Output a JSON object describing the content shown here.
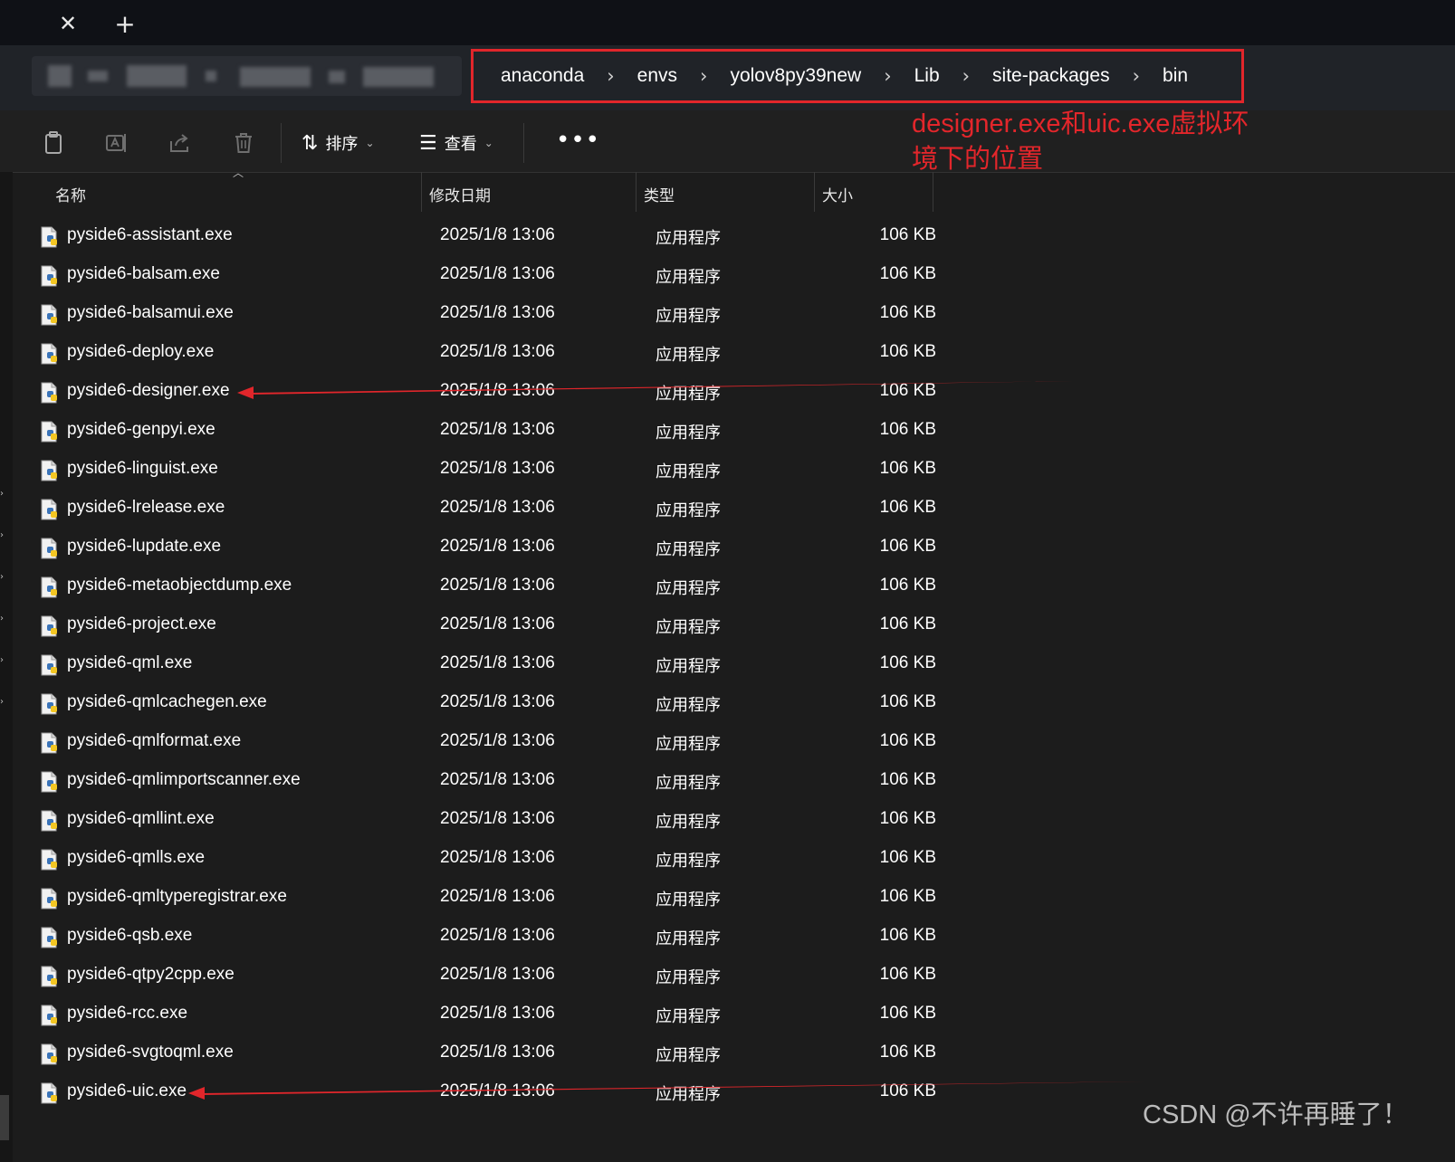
{
  "tabbar": {
    "close_glyph": "✕",
    "new_tab_glyph": "+"
  },
  "breadcrumbs": [
    "anaconda",
    "envs",
    "yolov8py39new",
    "Lib",
    "site-packages",
    "bin"
  ],
  "toolbar": {
    "icons": [
      "clipboard-icon",
      "rename-icon",
      "share-icon",
      "delete-icon"
    ],
    "sort_label": "排序",
    "view_label": "查看",
    "more_label": "•••"
  },
  "annotation": {
    "text_line1": "designer.exe和uic.exe虚拟环",
    "text_line2": "境下的位置",
    "color": "#e3262b"
  },
  "columns": {
    "name": "名称",
    "date": "修改日期",
    "type": "类型",
    "size": "大小"
  },
  "files": [
    {
      "name": "pyside6-assistant.exe",
      "date": "2025/1/8 13:06",
      "type": "应用程序",
      "size": "106 KB"
    },
    {
      "name": "pyside6-balsam.exe",
      "date": "2025/1/8 13:06",
      "type": "应用程序",
      "size": "106 KB"
    },
    {
      "name": "pyside6-balsamui.exe",
      "date": "2025/1/8 13:06",
      "type": "应用程序",
      "size": "106 KB"
    },
    {
      "name": "pyside6-deploy.exe",
      "date": "2025/1/8 13:06",
      "type": "应用程序",
      "size": "106 KB"
    },
    {
      "name": "pyside6-designer.exe",
      "date": "2025/1/8 13:06",
      "type": "应用程序",
      "size": "106 KB"
    },
    {
      "name": "pyside6-genpyi.exe",
      "date": "2025/1/8 13:06",
      "type": "应用程序",
      "size": "106 KB"
    },
    {
      "name": "pyside6-linguist.exe",
      "date": "2025/1/8 13:06",
      "type": "应用程序",
      "size": "106 KB"
    },
    {
      "name": "pyside6-lrelease.exe",
      "date": "2025/1/8 13:06",
      "type": "应用程序",
      "size": "106 KB"
    },
    {
      "name": "pyside6-lupdate.exe",
      "date": "2025/1/8 13:06",
      "type": "应用程序",
      "size": "106 KB"
    },
    {
      "name": "pyside6-metaobjectdump.exe",
      "date": "2025/1/8 13:06",
      "type": "应用程序",
      "size": "106 KB"
    },
    {
      "name": "pyside6-project.exe",
      "date": "2025/1/8 13:06",
      "type": "应用程序",
      "size": "106 KB"
    },
    {
      "name": "pyside6-qml.exe",
      "date": "2025/1/8 13:06",
      "type": "应用程序",
      "size": "106 KB"
    },
    {
      "name": "pyside6-qmlcachegen.exe",
      "date": "2025/1/8 13:06",
      "type": "应用程序",
      "size": "106 KB"
    },
    {
      "name": "pyside6-qmlformat.exe",
      "date": "2025/1/8 13:06",
      "type": "应用程序",
      "size": "106 KB"
    },
    {
      "name": "pyside6-qmlimportscanner.exe",
      "date": "2025/1/8 13:06",
      "type": "应用程序",
      "size": "106 KB"
    },
    {
      "name": "pyside6-qmllint.exe",
      "date": "2025/1/8 13:06",
      "type": "应用程序",
      "size": "106 KB"
    },
    {
      "name": "pyside6-qmlls.exe",
      "date": "2025/1/8 13:06",
      "type": "应用程序",
      "size": "106 KB"
    },
    {
      "name": "pyside6-qmltyperegistrar.exe",
      "date": "2025/1/8 13:06",
      "type": "应用程序",
      "size": "106 KB"
    },
    {
      "name": "pyside6-qsb.exe",
      "date": "2025/1/8 13:06",
      "type": "应用程序",
      "size": "106 KB"
    },
    {
      "name": "pyside6-qtpy2cpp.exe",
      "date": "2025/1/8 13:06",
      "type": "应用程序",
      "size": "106 KB"
    },
    {
      "name": "pyside6-rcc.exe",
      "date": "2025/1/8 13:06",
      "type": "应用程序",
      "size": "106 KB"
    },
    {
      "name": "pyside6-svgtoqml.exe",
      "date": "2025/1/8 13:06",
      "type": "应用程序",
      "size": "106 KB"
    },
    {
      "name": "pyside6-uic.exe",
      "date": "2025/1/8 13:06",
      "type": "应用程序",
      "size": "106 KB"
    }
  ],
  "highlighted_rows": [
    4,
    22
  ],
  "watermark": "CSDN @不许再睡了！",
  "colors": {
    "background": "#1c1c1c",
    "accent_red": "#e1262b",
    "text": "#ffffff"
  }
}
